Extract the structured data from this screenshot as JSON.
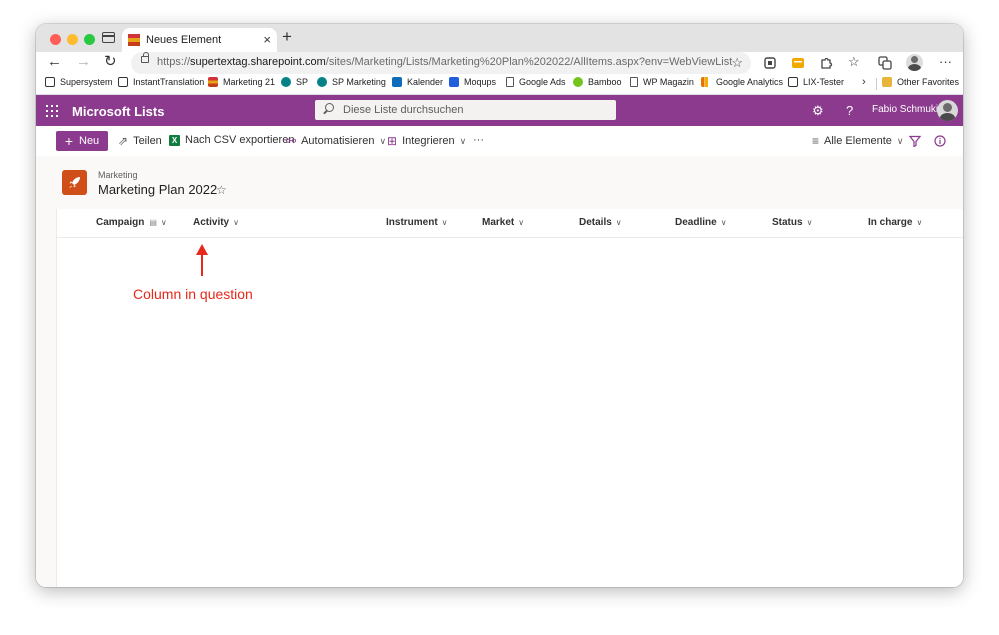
{
  "browser": {
    "tab_title": "Neues Element",
    "url_prefix": "https://",
    "url_host": "supertextag.sharepoint.com",
    "url_path": "/sites/Marketing/Lists/Marketing%20Plan%202022/AllItems.aspx?env=WebViewList"
  },
  "bookmarks": [
    {
      "label": "Supersystem",
      "color": "#333333"
    },
    {
      "label": "InstantTranslation",
      "color": "#333333"
    },
    {
      "label": "Marketing 21",
      "color": "#c43e1c"
    },
    {
      "label": "SP",
      "color": "#038387"
    },
    {
      "label": "SP Marketing",
      "color": "#038387"
    },
    {
      "label": "Kalender",
      "color": "#0f6cbd"
    },
    {
      "label": "Moqups",
      "color": "#1f5fd9"
    },
    {
      "label": "Google Ads",
      "color": "#555555"
    },
    {
      "label": "Bamboo",
      "color": "#73c41d"
    },
    {
      "label": "WP Magazin",
      "color": "#555555"
    },
    {
      "label": "Google Analytics",
      "color": "#f9ab00"
    },
    {
      "label": "LIX-Tester",
      "color": "#333333"
    },
    {
      "label": "Other Favorites",
      "color": "#e8b53b"
    }
  ],
  "suite": {
    "app_name": "Microsoft Lists",
    "search_placeholder": "Diese Liste durchsuchen",
    "user_name": "Fabio Schmuki",
    "accent": "#8b3a8e"
  },
  "commands": {
    "new": "Neu",
    "share": "Teilen",
    "export": "Nach CSV exportieren",
    "automate": "Automatisieren",
    "integrate": "Integrieren",
    "more": "···",
    "view": "Alle Elemente"
  },
  "list": {
    "site": "Marketing",
    "title": "Marketing Plan 2022",
    "columns": [
      "Campaign",
      "Activity",
      "Instrument",
      "Market",
      "Details",
      "Deadline",
      "Status",
      "In charge"
    ]
  },
  "annotation": {
    "text": "Column in question",
    "color": "#e8281a"
  }
}
